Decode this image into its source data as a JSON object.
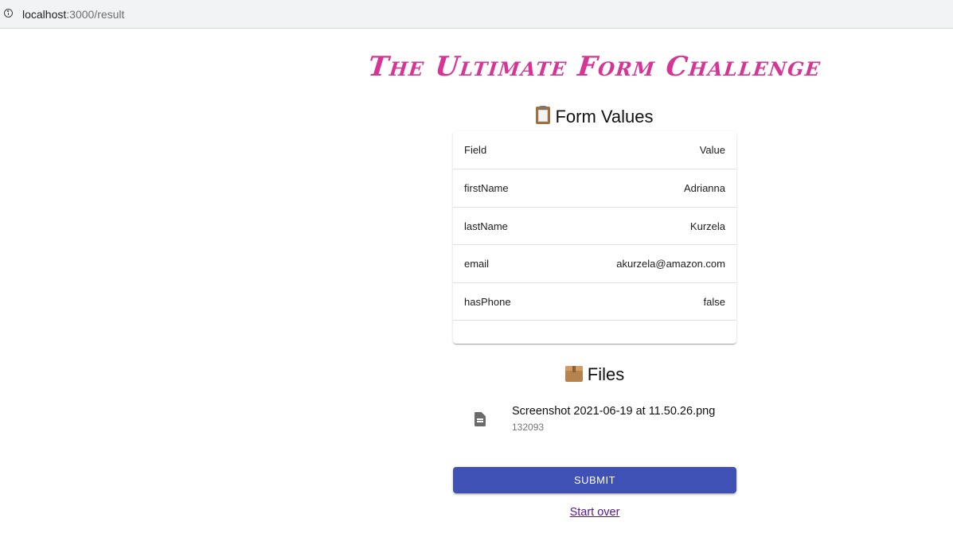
{
  "browser": {
    "url_host": "localhost",
    "url_path": ":3000/result"
  },
  "page": {
    "title": "The Ultimate Form Challenge"
  },
  "form_values": {
    "heading": "Form Values",
    "icon": "clipboard-icon",
    "columns": {
      "field": "Field",
      "value": "Value"
    },
    "rows": [
      {
        "field": "firstName",
        "value": "Adrianna"
      },
      {
        "field": "lastName",
        "value": "Kurzela"
      },
      {
        "field": "email",
        "value": "akurzela@amazon.com"
      },
      {
        "field": "hasPhone",
        "value": "false"
      }
    ]
  },
  "files": {
    "heading": "Files",
    "icon": "package-icon",
    "items": [
      {
        "name": "Screenshot 2021-06-19 at 11.50.26.png",
        "size": "132093",
        "icon": "file-icon"
      }
    ]
  },
  "actions": {
    "submit_label": "SUBMIT",
    "start_over_label": "Start over"
  },
  "colors": {
    "title": "#d63596",
    "primary": "#3f51b5",
    "link": "#551a8b"
  }
}
